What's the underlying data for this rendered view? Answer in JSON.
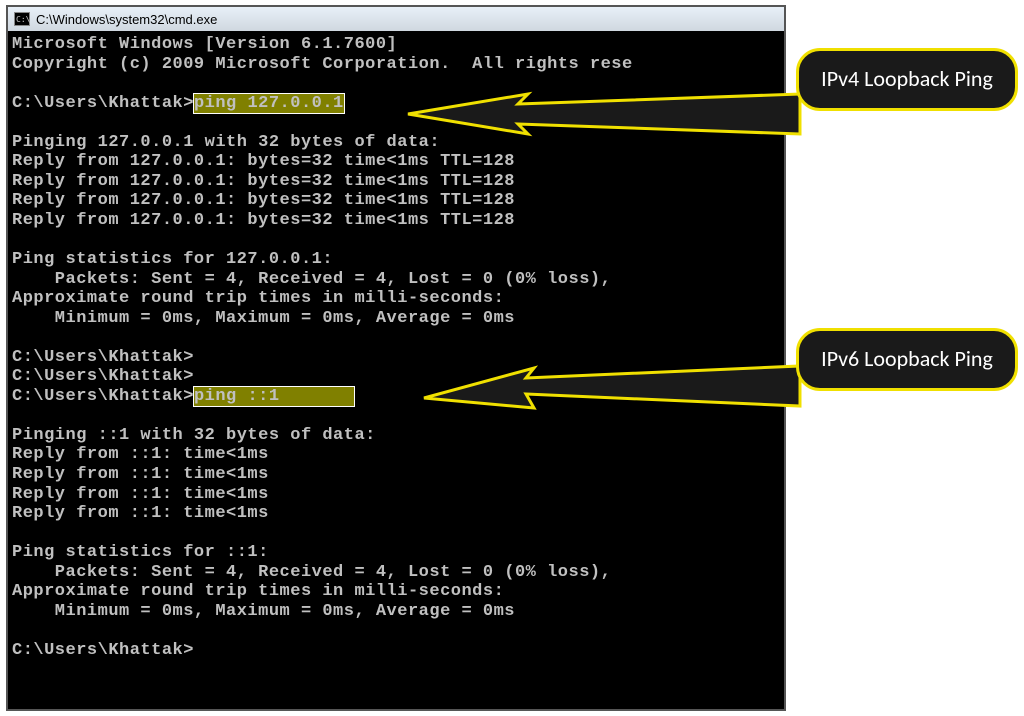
{
  "titlebar": {
    "icon": "C:\\",
    "path": "C:\\Windows\\system32\\cmd.exe"
  },
  "terminal": {
    "l1": "Microsoft Windows [Version 6.1.7600]",
    "l2": "Copyright (c) 2009 Microsoft Corporation.  All rights rese",
    "l3": "",
    "l4a": "C:\\Users\\Khattak>",
    "cmd1": "ping 127.0.0.1",
    "l5": "",
    "l6": "Pinging 127.0.0.1 with 32 bytes of data:",
    "l7": "Reply from 127.0.0.1: bytes=32 time<1ms TTL=128",
    "l8": "Reply from 127.0.0.1: bytes=32 time<1ms TTL=128",
    "l9": "Reply from 127.0.0.1: bytes=32 time<1ms TTL=128",
    "l10": "Reply from 127.0.0.1: bytes=32 time<1ms TTL=128",
    "l11": "",
    "l12": "Ping statistics for 127.0.0.1:",
    "l13": "    Packets: Sent = 4, Received = 4, Lost = 0 (0% loss),",
    "l14": "Approximate round trip times in milli-seconds:",
    "l15": "    Minimum = 0ms, Maximum = 0ms, Average = 0ms",
    "l16": "",
    "l17": "C:\\Users\\Khattak>",
    "l18": "C:\\Users\\Khattak>",
    "l19a": "C:\\Users\\Khattak>",
    "cmd2": "ping ::1       ",
    "l20": "",
    "l21": "Pinging ::1 with 32 bytes of data:",
    "l22": "Reply from ::1: time<1ms",
    "l23": "Reply from ::1: time<1ms",
    "l24": "Reply from ::1: time<1ms",
    "l25": "Reply from ::1: time<1ms",
    "l26": "",
    "l27": "Ping statistics for ::1:",
    "l28": "    Packets: Sent = 4, Received = 4, Lost = 0 (0% loss),",
    "l29": "Approximate round trip times in milli-seconds:",
    "l30": "    Minimum = 0ms, Maximum = 0ms, Average = 0ms",
    "l31": "",
    "l32": "C:\\Users\\Khattak>"
  },
  "callouts": {
    "ipv4": "IPv4 Loopback Ping",
    "ipv6": "IPv6 Loopback Ping"
  }
}
